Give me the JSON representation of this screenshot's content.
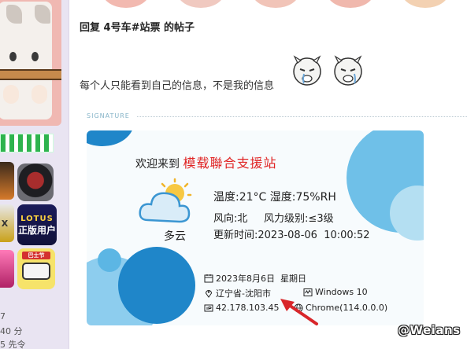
{
  "sidebar": {
    "stats": [
      "7",
      "40 分",
      "5 先令"
    ],
    "medals": {
      "lotus_top": "LOTUS",
      "lotus_bottom": "正版用户",
      "bus_tag": "巴士节"
    }
  },
  "post": {
    "reply_title": "回复 4号车#站票 的帖子",
    "text": "每个人只能看到自己的信息，不是我的信息"
  },
  "signature": {
    "label": "SIGNATURE",
    "welcome_prefix": "欢迎来到",
    "site_name": "模载聯合支援站",
    "weather_text": "多云",
    "temp_line": "温度:21°C 湿度:75%RH",
    "wind_line": "风向:北     风力级别:≤3级",
    "update_line": "更新时间:2023-08-06  10:00:52",
    "date_line": "2023年8月6日  星期日",
    "location": "辽宁省-沈阳市",
    "os": "Windows 10",
    "ip": "42.178.103.45",
    "browser": "Chrome(114.0.0.0)"
  },
  "watermark": "@Weians",
  "colors": {
    "accent_red": "#e02525",
    "sidebar_bg": "#e9e4f2",
    "card_blue": "#1f86c9",
    "card_light_blue": "#6fc0e8"
  }
}
